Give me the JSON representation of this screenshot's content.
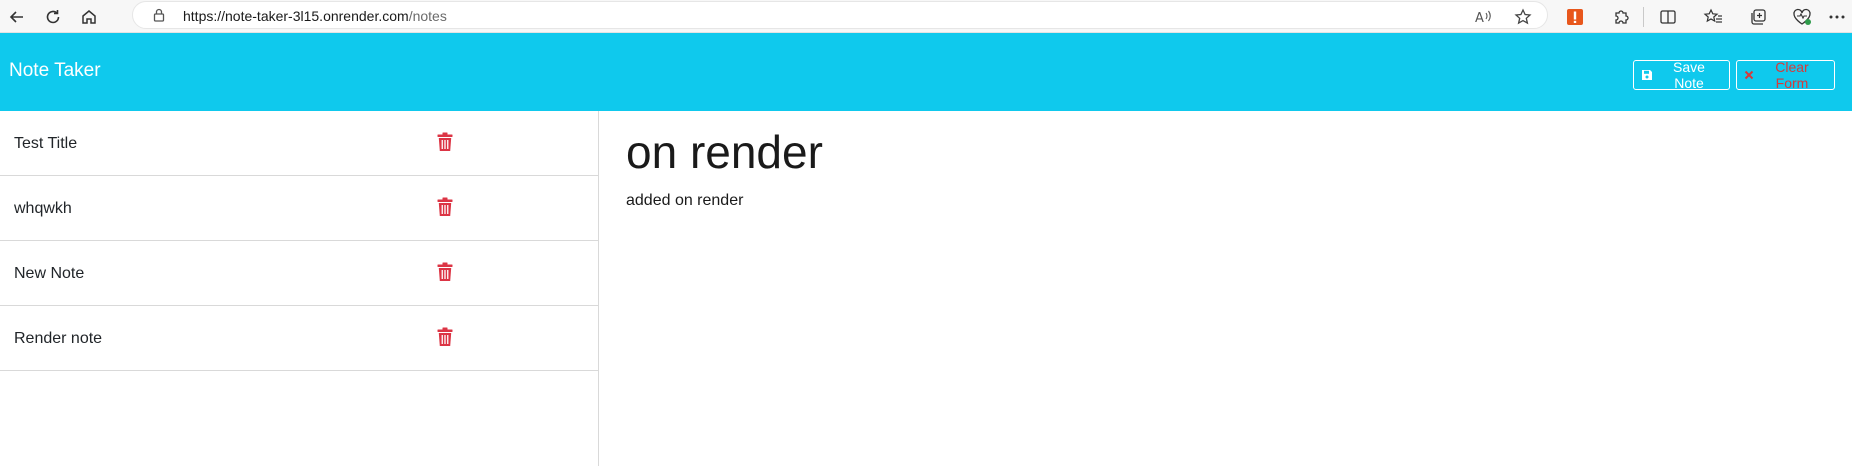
{
  "browser": {
    "url_host": "https://note-taker-3l15.onrender.com",
    "url_path": "/notes",
    "icons": {
      "back": "back-arrow-icon",
      "refresh": "refresh-icon",
      "home": "home-icon",
      "lock": "lock-icon",
      "read_aloud": "read-aloud-icon",
      "favorite": "star-icon",
      "extension_alert": "alert-extension-icon",
      "extensions": "puzzle-icon",
      "split_screen": "split-screen-icon",
      "favorites": "favorites-list-icon",
      "collections": "collections-icon",
      "health": "browser-essentials-icon",
      "more": "more-icon"
    }
  },
  "header": {
    "title": "Note Taker",
    "save_label": "Save Note",
    "clear_label": "Clear Form",
    "colors": {
      "background": "#0fc9ed",
      "clear_text": "#d63a3a"
    }
  },
  "notes": [
    {
      "title": "Test Title"
    },
    {
      "title": "whqwkh"
    },
    {
      "title": "New Note"
    },
    {
      "title": "Render note"
    }
  ],
  "editor": {
    "title_value": "on render",
    "text_value": "added on render"
  },
  "colors": {
    "delete_icon": "#dc3545"
  }
}
